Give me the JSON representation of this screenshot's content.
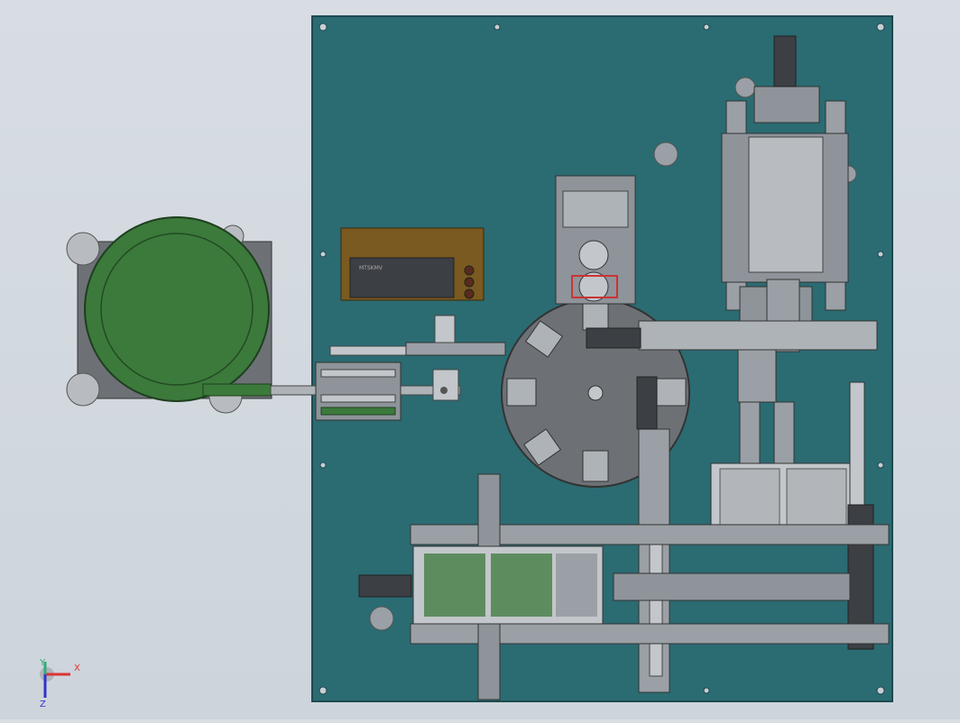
{
  "scene": {
    "background_color": "#d3dae0",
    "plate_color": "#2b6b72",
    "hopper_color": "#3b7a3b",
    "frame_color": "#9a9fa6",
    "controller_color": "#7a5a20"
  },
  "controller": {
    "badge": "MTSKMV"
  },
  "triad": {
    "x_label": "X",
    "y_label": "Y",
    "z_label": "Z"
  }
}
